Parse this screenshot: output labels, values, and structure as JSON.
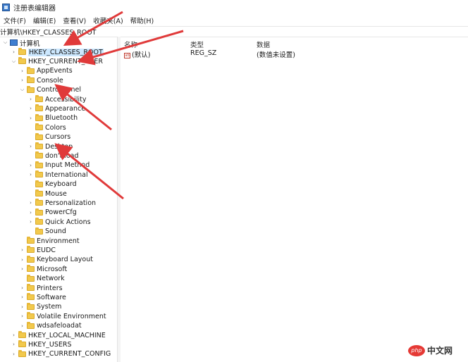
{
  "window": {
    "title": "注册表编辑器"
  },
  "menu": [
    "文件(F)",
    "编辑(E)",
    "查看(V)",
    "收藏夹(A)",
    "帮助(H)"
  ],
  "address": "计算机\\HKEY_CLASSES_ROOT",
  "tree": [
    {
      "label": "计算机",
      "depth": 0,
      "expander": "open",
      "icon": "computer-icon"
    },
    {
      "label": "HKEY_CLASSES_ROOT",
      "depth": 1,
      "expander": "closed",
      "icon": "folder-icon",
      "selected": true
    },
    {
      "label": "HKEY_CURRENT_USER",
      "depth": 1,
      "expander": "open",
      "icon": "folder-icon"
    },
    {
      "label": "AppEvents",
      "depth": 2,
      "expander": "closed",
      "icon": "folder-icon"
    },
    {
      "label": "Console",
      "depth": 2,
      "expander": "closed",
      "icon": "folder-icon"
    },
    {
      "label": "Control Panel",
      "depth": 2,
      "expander": "open",
      "icon": "folder-icon"
    },
    {
      "label": "Accessibility",
      "depth": 3,
      "expander": "closed",
      "icon": "folder-icon"
    },
    {
      "label": "Appearance",
      "depth": 3,
      "expander": "closed",
      "icon": "folder-icon"
    },
    {
      "label": "Bluetooth",
      "depth": 3,
      "expander": "closed",
      "icon": "folder-icon"
    },
    {
      "label": "Colors",
      "depth": 3,
      "expander": "none",
      "icon": "folder-icon"
    },
    {
      "label": "Cursors",
      "depth": 3,
      "expander": "none",
      "icon": "folder-icon"
    },
    {
      "label": "Desktop",
      "depth": 3,
      "expander": "closed",
      "icon": "folder-icon"
    },
    {
      "label": "don't load",
      "depth": 3,
      "expander": "none",
      "icon": "folder-icon"
    },
    {
      "label": "Input Method",
      "depth": 3,
      "expander": "closed",
      "icon": "folder-icon"
    },
    {
      "label": "International",
      "depth": 3,
      "expander": "closed",
      "icon": "folder-icon"
    },
    {
      "label": "Keyboard",
      "depth": 3,
      "expander": "none",
      "icon": "folder-icon"
    },
    {
      "label": "Mouse",
      "depth": 3,
      "expander": "none",
      "icon": "folder-icon"
    },
    {
      "label": "Personalization",
      "depth": 3,
      "expander": "closed",
      "icon": "folder-icon"
    },
    {
      "label": "PowerCfg",
      "depth": 3,
      "expander": "closed",
      "icon": "folder-icon"
    },
    {
      "label": "Quick Actions",
      "depth": 3,
      "expander": "closed",
      "icon": "folder-icon"
    },
    {
      "label": "Sound",
      "depth": 3,
      "expander": "none",
      "icon": "folder-icon"
    },
    {
      "label": "Environment",
      "depth": 2,
      "expander": "none",
      "icon": "folder-icon"
    },
    {
      "label": "EUDC",
      "depth": 2,
      "expander": "closed",
      "icon": "folder-icon"
    },
    {
      "label": "Keyboard Layout",
      "depth": 2,
      "expander": "closed",
      "icon": "folder-icon"
    },
    {
      "label": "Microsoft",
      "depth": 2,
      "expander": "closed",
      "icon": "folder-icon"
    },
    {
      "label": "Network",
      "depth": 2,
      "expander": "none",
      "icon": "folder-icon"
    },
    {
      "label": "Printers",
      "depth": 2,
      "expander": "closed",
      "icon": "folder-icon"
    },
    {
      "label": "Software",
      "depth": 2,
      "expander": "closed",
      "icon": "folder-icon"
    },
    {
      "label": "System",
      "depth": 2,
      "expander": "closed",
      "icon": "folder-icon"
    },
    {
      "label": "Volatile Environment",
      "depth": 2,
      "expander": "closed",
      "icon": "folder-icon"
    },
    {
      "label": "wdsafeloadat",
      "depth": 2,
      "expander": "closed",
      "icon": "folder-icon"
    },
    {
      "label": "HKEY_LOCAL_MACHINE",
      "depth": 1,
      "expander": "closed",
      "icon": "folder-icon"
    },
    {
      "label": "HKEY_USERS",
      "depth": 1,
      "expander": "closed",
      "icon": "folder-icon"
    },
    {
      "label": "HKEY_CURRENT_CONFIG",
      "depth": 1,
      "expander": "closed",
      "icon": "folder-icon"
    }
  ],
  "columns": {
    "name": "名称",
    "type": "类型",
    "data": "数据"
  },
  "values": [
    {
      "name": "(默认)",
      "type": "REG_SZ",
      "data": "(数值未设置)",
      "icon": "string-value-icon"
    }
  ],
  "watermark": {
    "badge": "php",
    "text": "中文网"
  },
  "colors": {
    "selection": "#cce8ff",
    "annotation_arrow": "#e03a3a",
    "folder": "#f2c94c"
  }
}
